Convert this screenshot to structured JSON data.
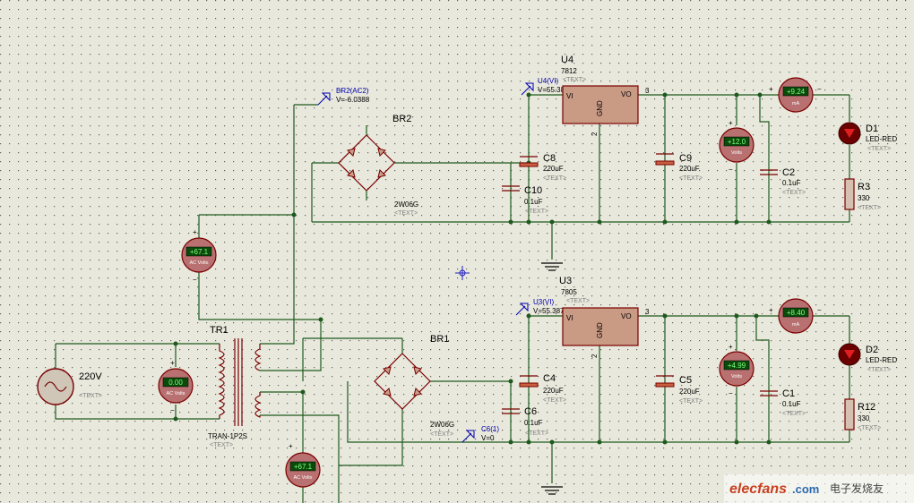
{
  "transformer": {
    "name": "TR1",
    "model": "TRAN-1P2S",
    "text": "<TEXT>"
  },
  "source": {
    "label": "220V",
    "text": "<TEXT>"
  },
  "bridges": [
    {
      "name": "BR2",
      "model": "2W06G",
      "text": "<TEXT>"
    },
    {
      "name": "BR1",
      "model": "2W06G",
      "text": "<TEXT>"
    }
  ],
  "regulators": [
    {
      "name": "U4",
      "model": "7812",
      "text": "<TEXT>",
      "pin_vi": "VI",
      "pin_vo": "VO",
      "pin_gnd": "GND",
      "pin3": "3",
      "pin2": "2"
    },
    {
      "name": "U3",
      "model": "7805",
      "text": "<TEXT>",
      "pin_vi": "VI",
      "pin_vo": "VO",
      "pin_gnd": "GND",
      "pin3": "3",
      "pin2": "2"
    }
  ],
  "probes": [
    {
      "label": "BR2(AC2)",
      "value": "V=-6.0388"
    },
    {
      "label": "U4(VI)",
      "value": "V=55.3837"
    },
    {
      "label": "U3(VI)",
      "value": "V=55.3876"
    },
    {
      "label": "C6(1)",
      "value": "V=0"
    }
  ],
  "capacitors": [
    {
      "name": "C8",
      "value": "220uF",
      "text": "<TEXT>"
    },
    {
      "name": "C10",
      "value": "0.1uF",
      "text": "<TEXT>"
    },
    {
      "name": "C9",
      "value": "220uF",
      "text": "<TEXT>"
    },
    {
      "name": "C2",
      "value": "0.1uF",
      "text": "<TEXT>"
    },
    {
      "name": "C4",
      "value": "220uF",
      "text": "<TEXT>"
    },
    {
      "name": "C6",
      "value": "0.1uF",
      "text": "<TEXT>"
    },
    {
      "name": "C5",
      "value": "220uF",
      "text": "<TEXT>"
    },
    {
      "name": "C1",
      "value": "0.1uF",
      "text": "<TEXT>"
    }
  ],
  "leds": [
    {
      "name": "D1",
      "model": "LED-RED",
      "text": "<TEXT>"
    },
    {
      "name": "D2",
      "model": "LED-RED",
      "text": "<TEXT>"
    }
  ],
  "resistors": [
    {
      "name": "R3",
      "value": "330",
      "text": "<TEXT>"
    },
    {
      "name": "R12",
      "value": "330",
      "text": "<TEXT>"
    }
  ],
  "meters": [
    {
      "reading": "+67.1",
      "unit": "AC Volts"
    },
    {
      "reading": "0.00",
      "unit": "AC Volts"
    },
    {
      "reading": "+67.1",
      "unit": "AC Volts"
    },
    {
      "reading": "+12.0",
      "unit": "Volts"
    },
    {
      "reading": "+9.24",
      "unit": "mA"
    },
    {
      "reading": "+4.99",
      "unit": "Volts"
    },
    {
      "reading": "+8.40",
      "unit": "mA"
    }
  ],
  "signs": {
    "plus": "+",
    "minus": "−"
  },
  "watermark": {
    "brand": "elecfans",
    "domain": ".com",
    "cn": "电子发烧友"
  }
}
